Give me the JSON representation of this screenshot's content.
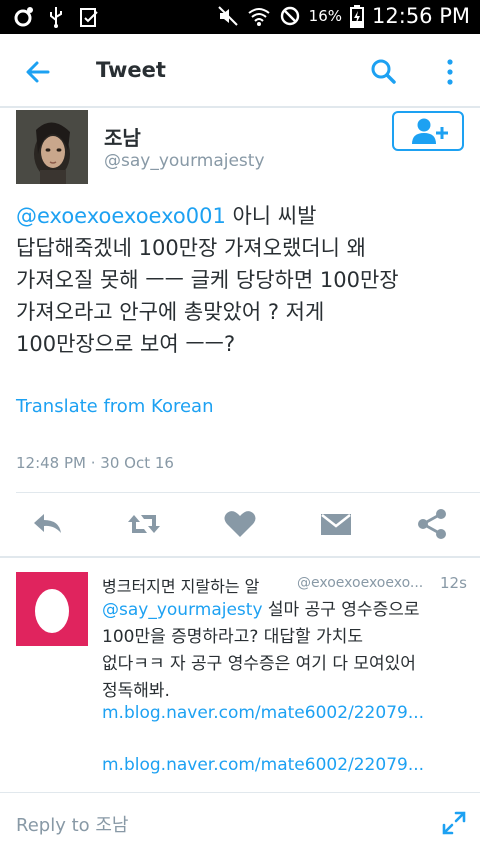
{
  "status_bar": {
    "battery_percent": "16%",
    "time": "12:56 PM"
  },
  "app_bar": {
    "title": "Tweet"
  },
  "tweet": {
    "author_name": "조남",
    "author_handle": "@say_yourmajesty",
    "mention": "@exoexoexoexo001",
    "text_lines": [
      " 아니 씨발",
      "답답해죽겠네 100만장 가져오랬더니 왜",
      "가져오질 못해 ㅡㅡ 글케 당당하면 100만장",
      "가져오라고 안구에 총맞았어 ? 저게",
      "100만장으로 보여 ㅡㅡ?"
    ],
    "translate_label": "Translate from Korean",
    "timestamp": "12:48 PM · 30 Oct 16"
  },
  "reply": {
    "name": "병크터지면 지랄하는 알",
    "handle": "@exoexoexoexo...",
    "time": "12s",
    "mention": "@say_yourmajesty",
    "text_lines": [
      " 설마 공구 영수증으로",
      "100만을 증명하라고? 대답할 가치도",
      "없다ㅋㅋ 자 공구 영수증은 여기 다 모여있어",
      "정독해봐."
    ],
    "links": [
      "m.blog.naver.com/mate6002/22079...",
      "m.blog.naver.com/mate6002/22079..."
    ]
  },
  "reply_bar": {
    "placeholder": "Reply to 조남"
  },
  "colors": {
    "accent": "#1da1f2",
    "icon_gray": "#8899a6",
    "egg_avatar": "#e0245e"
  }
}
